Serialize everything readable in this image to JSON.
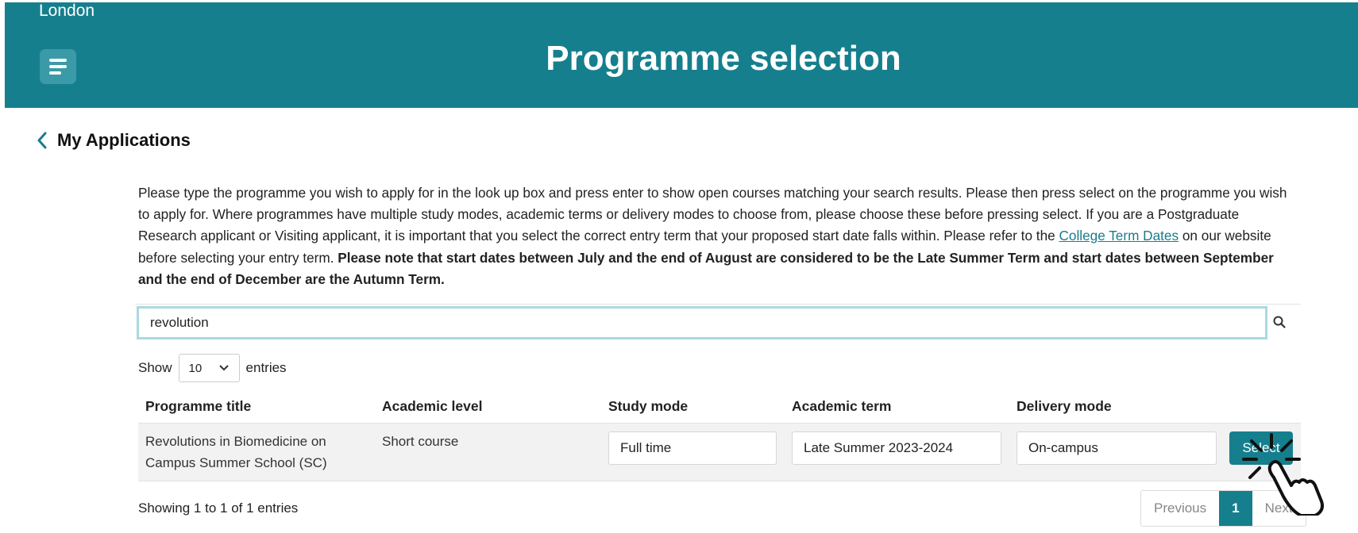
{
  "header": {
    "org_name": "London",
    "title": "Programme selection",
    "menu_icon": "hamburger-icon",
    "bg_color": "#167f8e"
  },
  "back_link": {
    "label": "My Applications",
    "icon": "chevron-left-icon"
  },
  "intro": {
    "part1": "Please type the programme you wish to apply for in the look up box and press enter to show open courses matching your search results. Please then press select on the programme you wish to apply for. Where programmes have multiple study modes, academic terms or delivery modes to choose from, please choose these before pressing select. If you are a Postgraduate Research applicant or Visiting applicant, it is important that you select the correct entry term that your proposed start date falls within. Please refer to the ",
    "link": "College Term Dates",
    "part2": " on our website before selecting your entry term. ",
    "bold": "Please note that start dates between July and the end of August are considered to be the Late Summer Term and start dates between September and the end of December are the Autumn Term."
  },
  "search": {
    "value": "revolution",
    "icon": "search-icon"
  },
  "entries": {
    "show_label": "Show",
    "selected": "10",
    "entries_label": "entries"
  },
  "table": {
    "columns": [
      "Programme title",
      "Academic level",
      "Study mode",
      "Academic term",
      "Delivery mode"
    ],
    "rows": [
      {
        "title": "Revolutions in Biomedicine on Campus Summer School (SC)",
        "level": "Short course",
        "study_mode": "Full time",
        "term": "Late Summer 2023-2024",
        "delivery": "On-campus",
        "action": "Select"
      }
    ]
  },
  "footer": {
    "info": "Showing 1 to 1 of 1 entries",
    "previous": "Previous",
    "page": "1",
    "next": "Next"
  }
}
